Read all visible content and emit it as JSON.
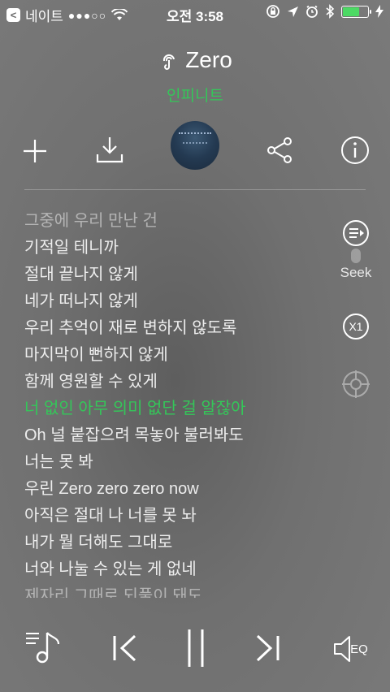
{
  "status_bar": {
    "carrier": "네이트",
    "time": "오전 3:58",
    "battery_level": 0.7,
    "colors": {
      "battery": "#4cd964"
    }
  },
  "song": {
    "title": "Zero",
    "artist": "인피니트"
  },
  "lyrics": {
    "lines": [
      "그중에 우리 만난 건",
      "기적일 테니까",
      "절대 끝나지 않게",
      "네가 떠나지 않게",
      "우리 추억이 재로 변하지 않도록",
      "마지막이 뻔하지 않게",
      "함께 영원할 수 있게",
      "너 없인 아무 의미 없단 걸 알잖아",
      "Oh 널 붙잡으려 목놓아 불러봐도",
      "너는 못 봐",
      "우린 Zero zero zero now",
      "아직은 절대 나 너를 못 놔",
      "내가 뭘 더해도 그대로",
      "너와 나눌 수 있는 게 없네",
      "제자리 그때로 되풀이 돼도"
    ],
    "active_index": 7
  },
  "side_panel": {
    "seek_label": "Seek",
    "speed_label": "X1"
  },
  "player_controls": {
    "eq_label": "EQ"
  },
  "icons": [
    "back-icon",
    "wifi-icon",
    "lock-rotation-icon",
    "location-icon",
    "alarm-icon",
    "bluetooth-icon",
    "battery-icon",
    "charging-icon",
    "audio-note-icon",
    "add-icon",
    "download-icon",
    "album-art",
    "share-icon",
    "info-icon",
    "seek-icon",
    "speed-icon",
    "target-icon",
    "playlist-icon",
    "previous-icon",
    "pause-icon",
    "next-icon",
    "eq-icon"
  ],
  "colors": {
    "accent": "#34c759",
    "text": "#f2f2f2"
  }
}
